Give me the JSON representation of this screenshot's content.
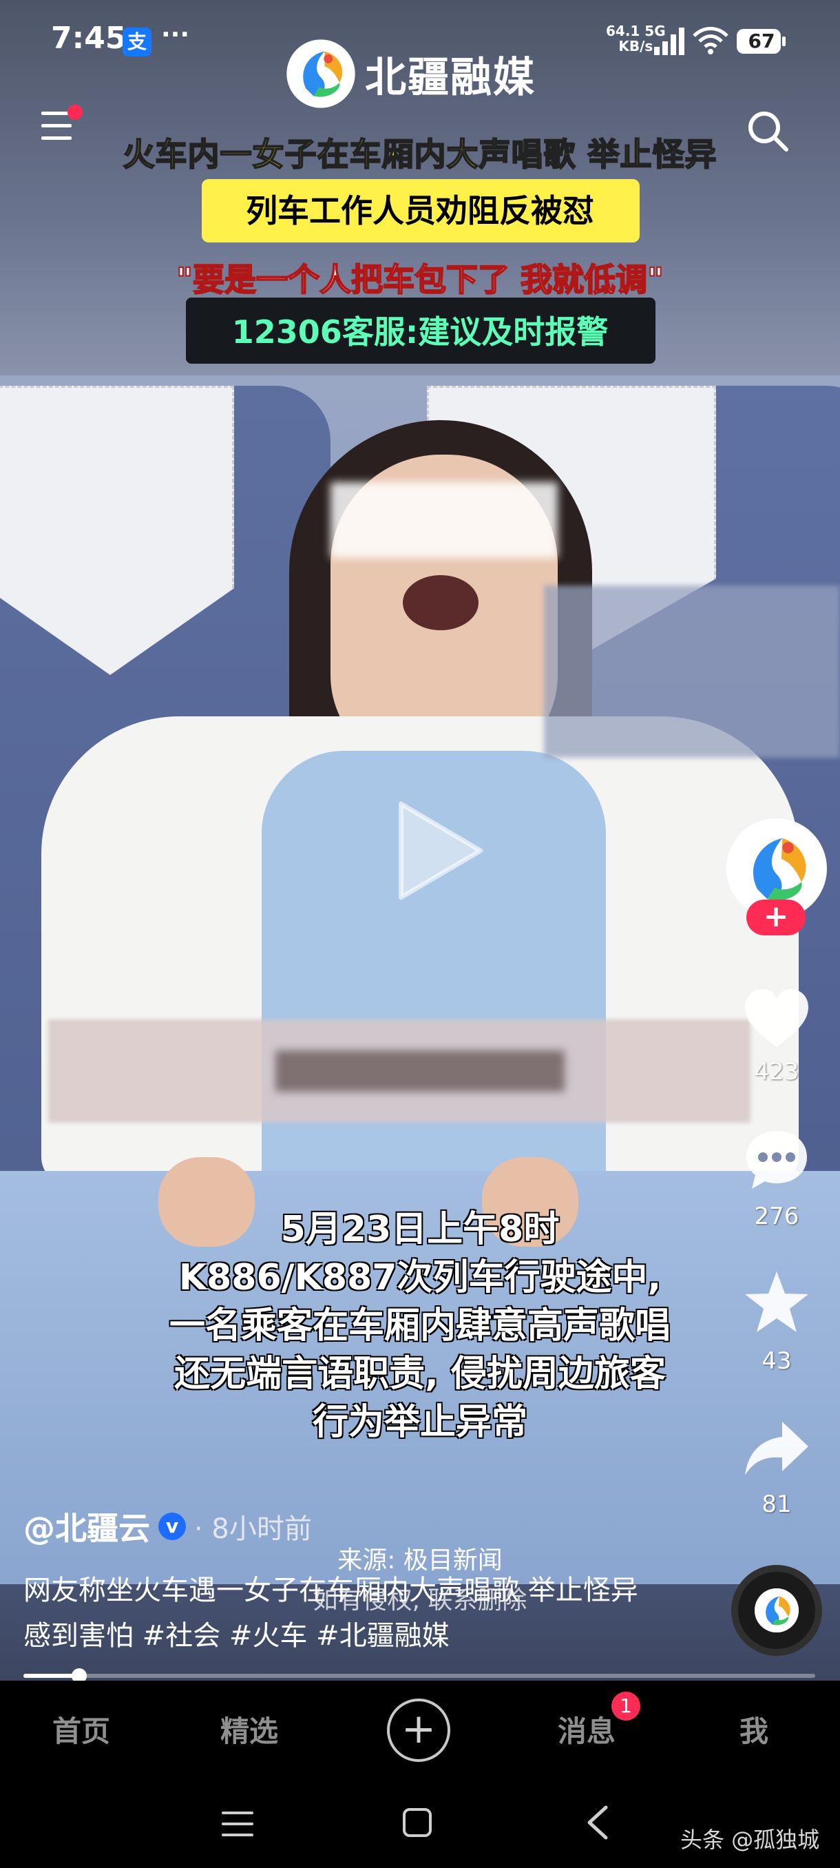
{
  "status_bar": {
    "time": "7:45",
    "alipay_glyph": "支",
    "more": "···",
    "net_speed_top": "64.1 5G",
    "net_speed_bottom": "KB/s",
    "battery": "67"
  },
  "video": {
    "brand_name": "北疆融媒",
    "headline_1": "火车内一女子在车厢内大声唱歌  举止怪异",
    "headline_2": "列车工作人员劝阻反被怼",
    "headline_3": "\"要是一个人把车包下了  我就低调\"",
    "headline_4": "12306客服:建议及时报警",
    "subtitle_lines": [
      "5月23日上午8时",
      "K886/K887次列车行驶途中,",
      "一名乘客在车厢内肆意高声歌唱",
      "还无端言语职责, 侵扰周边旅客",
      "行为举止异常"
    ],
    "source_1": "来源: 极目新闻",
    "source_2": "如有侵权, 联系删除",
    "progress_fraction": 0.07
  },
  "actions": {
    "follow": "+",
    "likes": "423",
    "comments": "276",
    "favorites": "43",
    "shares": "81"
  },
  "post": {
    "author": "@北疆云",
    "verified": "v",
    "time": "· 8小时前",
    "caption": "网友称坐火车遇一女子在车厢内大声唱歌 举止怪异 感到害怕 #社会 #火车 #北疆融媒"
  },
  "tabbar": {
    "home": "首页",
    "featured": "精选",
    "add": "+",
    "messages": "消息",
    "messages_badge": "1",
    "me": "我"
  },
  "watermark": "头条 @孤独城",
  "icons": {
    "like": "heart-icon",
    "comment": "comment-icon",
    "favorite": "star-icon",
    "share": "share-icon"
  }
}
